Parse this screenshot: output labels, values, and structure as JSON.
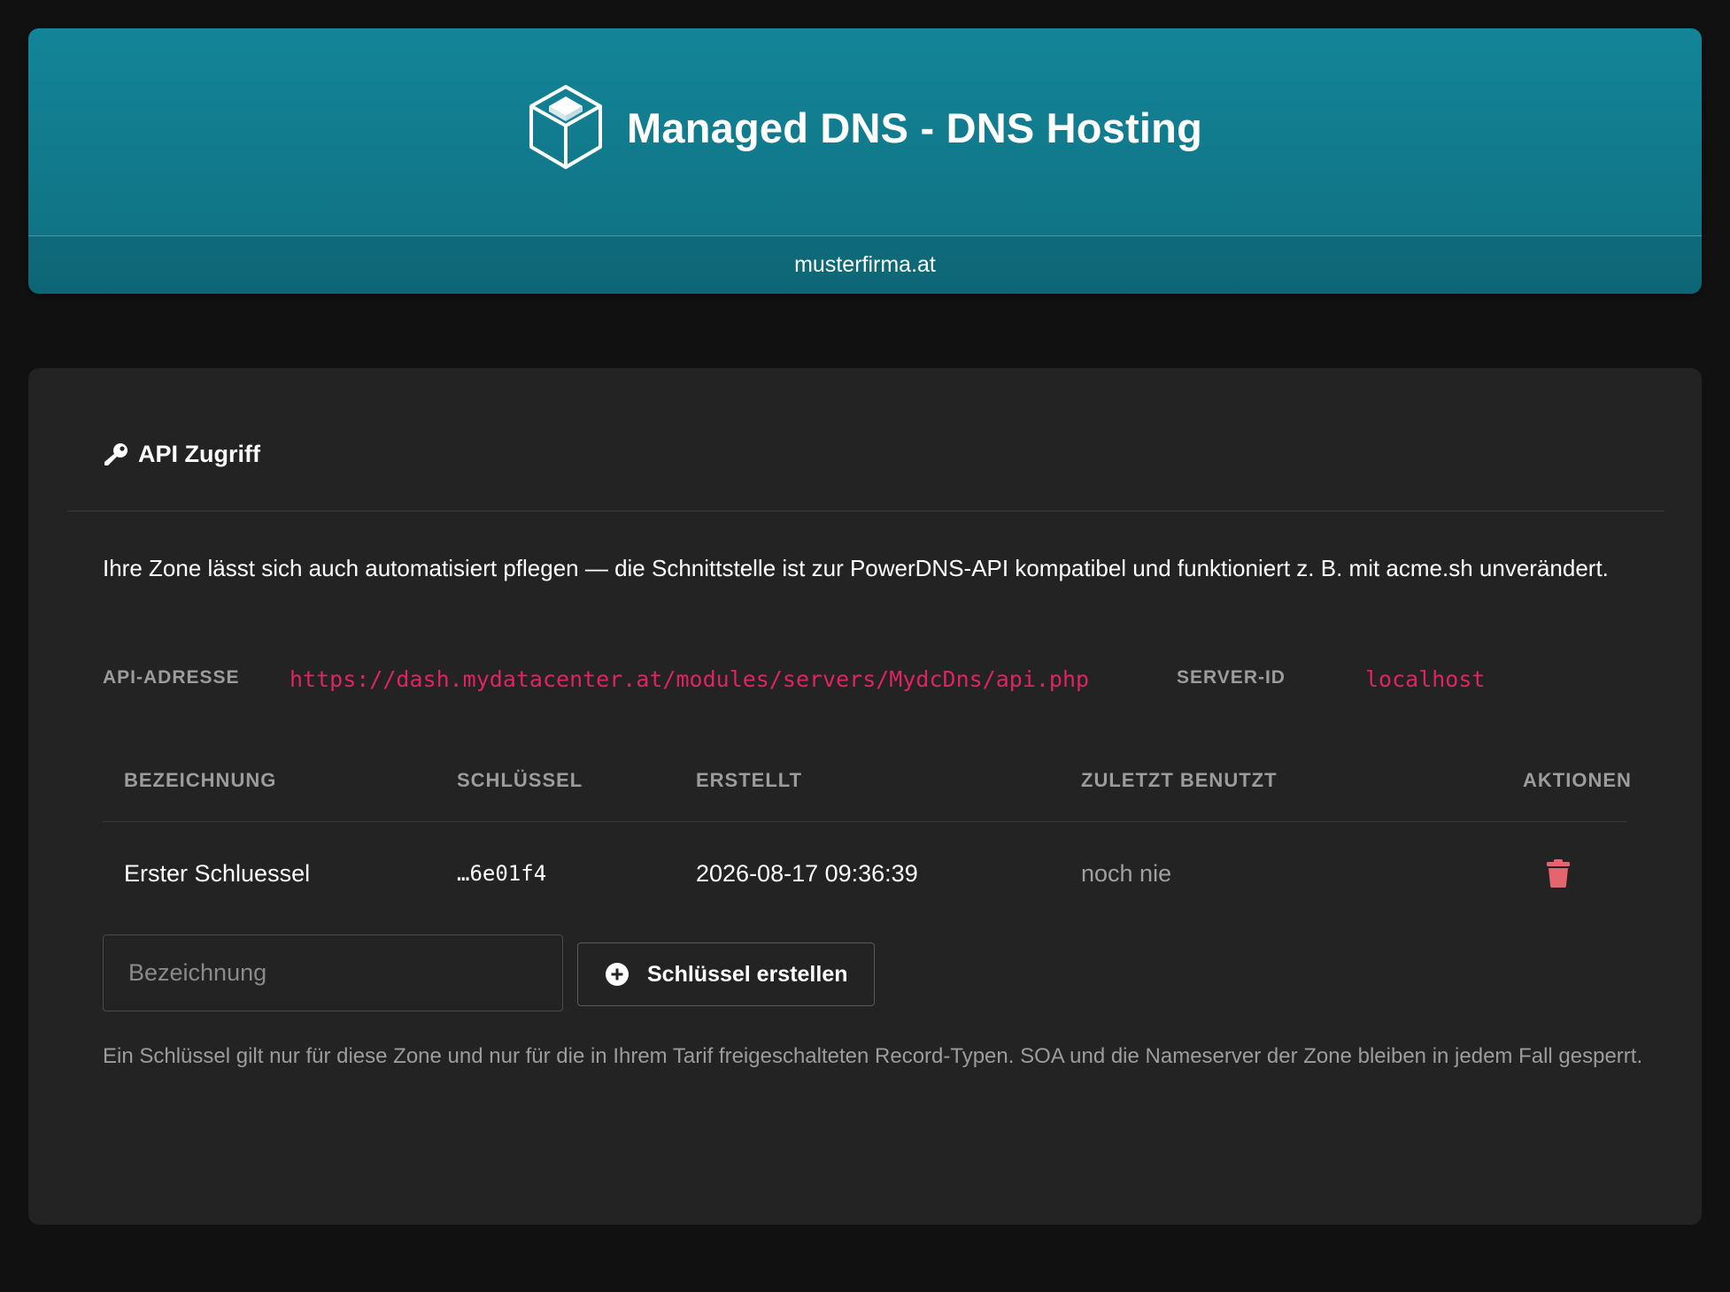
{
  "header": {
    "title": "Managed DNS - DNS Hosting",
    "domain": "musterfirma.at",
    "logo_icon": "cube-icon"
  },
  "api_section": {
    "heading": "API Zugriff",
    "heading_icon": "key-icon",
    "intro": "Ihre Zone lässt sich auch automatisiert pflegen — die Schnittstelle ist zur PowerDNS-API kompatibel und funktioniert z. B. mit acme.sh unverändert.",
    "api_address_label": "API-ADRESSE",
    "api_address_value": "https://dash.mydatacenter.at/modules/servers/MydcDns/api.php",
    "server_id_label": "SERVER-ID",
    "server_id_value": "localhost",
    "table": {
      "columns": [
        "BEZEICHNUNG",
        "SCHLÜSSEL",
        "ERSTELLT",
        "ZULETZT BENUTZT",
        "AKTIONEN"
      ],
      "rows": [
        {
          "name": "Erster Schluessel",
          "key": "…6e01f4",
          "created": "2026-08-17 09:36:39",
          "last_used": "noch nie",
          "action_icon": "trash-icon"
        }
      ]
    },
    "form": {
      "name_placeholder": "Bezeichnung",
      "name_value": "",
      "create_button_label": "Schlüssel erstellen",
      "create_button_icon": "plus-circle-icon"
    },
    "footnote": "Ein Schlüssel gilt nur für diese Zone und nur für die in Ihrem Tarif freigeschalteten Record-Typen. SOA und die Nameserver der Zone bleiben in jedem Fall gesperrt."
  },
  "colors": {
    "background": "#111111",
    "header_gradient_top": "#138598",
    "header_gradient_bottom": "#0f6f80",
    "card_background": "#232323",
    "accent_code": "#e0245e",
    "delete_icon": "#e5656e",
    "muted_text": "#9c9c9c"
  }
}
